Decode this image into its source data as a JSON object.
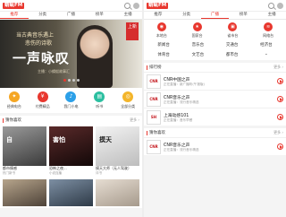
{
  "app": {
    "logo": "蜻蜓FM"
  },
  "left": {
    "tabs": [
      "推荐",
      "分类",
      "广播",
      "榜单",
      "主播"
    ],
    "active_tab": 0,
    "banner": {
      "line1": "当古典音乐遇上",
      "line2": "悲伤的诗歌",
      "title": "一声咏叹",
      "note": "主播：小蜻蜓故事汇",
      "corner": "上新"
    },
    "quick": [
      {
        "label": "经典电台",
        "color": "#f5a623",
        "glyph": "✦"
      },
      {
        "label": "付费精品",
        "color": "#e8372e",
        "glyph": "¥"
      },
      {
        "label": "我门小电",
        "color": "#2ca0e8",
        "glyph": "♪"
      },
      {
        "label": "听书",
        "color": "#2bbfa0",
        "glyph": "▤"
      },
      {
        "label": "全部分类",
        "color": "#f3b52b",
        "glyph": "◎"
      }
    ],
    "section": {
      "title": "猜你喜欢",
      "more": "更多 ›"
    },
    "grid": [
      {
        "title": "自",
        "caption": "都市情感",
        "sub": "热门新书",
        "bg": "#6a6a6a"
      },
      {
        "title": "害怕",
        "caption": "恐怖之夜...",
        "sub": "小说连播",
        "bg": "#3b1f1f"
      },
      {
        "title": "摸天",
        "caption": "摸天大师（无人驾驶）",
        "sub": "评书",
        "bg": "#e9e9e9"
      },
      {
        "title": "",
        "caption": "",
        "sub": "",
        "bg": "#8a7c6a"
      },
      {
        "title": "",
        "caption": "",
        "sub": "",
        "bg": "#5b6a7a"
      },
      {
        "title": "",
        "caption": "",
        "sub": "",
        "bg": "#cfc6bb"
      }
    ]
  },
  "right": {
    "tabs": [
      "推荐",
      "分类",
      "广播",
      "榜单",
      "主播"
    ],
    "active_tab": 2,
    "cats": [
      {
        "label": "本地台",
        "color": "#e8372e",
        "glyph": "◉"
      },
      {
        "label": "国家台",
        "color": "#e8372e",
        "glyph": "★"
      },
      {
        "label": "省市台",
        "color": "#e8372e",
        "glyph": "▣"
      },
      {
        "label": "网络台",
        "color": "#e8372e",
        "glyph": "≋"
      }
    ],
    "sub_cats": [
      "新闻台",
      "音乐台",
      "交通台",
      "经济台",
      "体育台",
      "文艺台",
      "都市台",
      ""
    ],
    "section1": {
      "title": "排行榜",
      "more": "更多 ›"
    },
    "list1": [
      {
        "logo": "CNR",
        "name": "CNR中国之声",
        "desc": "正在直播：新广播听(午报版)"
      },
      {
        "logo": "CNR",
        "name": "CNR音乐之声",
        "desc": "正在直播：流行音乐精选"
      },
      {
        "logo": "SH",
        "name": "上海动感101",
        "desc": "正在直播：音乐早餐"
      }
    ],
    "section2": {
      "title": "猜你喜欢",
      "more": "更多 ›"
    },
    "list2": [
      {
        "logo": "CNR",
        "name": "CNR音乐之声",
        "desc": "正在直播：流行音乐精选"
      }
    ]
  }
}
